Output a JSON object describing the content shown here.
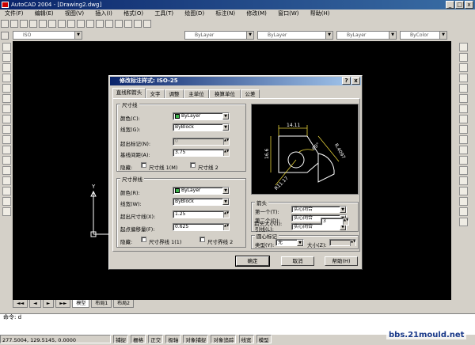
{
  "window": {
    "title": "AutoCAD 2004 - [Drawing2.dwg]",
    "min": "_",
    "max": "□",
    "close": "x"
  },
  "menu": [
    "文件(F)",
    "编辑(E)",
    "视图(V)",
    "插入(I)",
    "格式(O)",
    "工具(T)",
    "绘图(D)",
    "标注(N)",
    "修改(M)",
    "窗口(W)",
    "帮助(H)"
  ],
  "layers": {
    "layer_combo": "ByLayer",
    "linetype_combo": "ByLayer",
    "lineweight_combo": "ByLayer",
    "color_combo": "ByColor",
    "style_combo": "ISO"
  },
  "dialog": {
    "title": "修改标注样式: ISO-25",
    "tabs": [
      "直线和箭头",
      "文字",
      "调整",
      "主单位",
      "换算单位",
      "公差"
    ],
    "dimline": {
      "group_title": "尺寸线",
      "color_label": "颜色(C):",
      "color_value": "ByLayer",
      "lineweight_label": "线宽(G):",
      "lineweight_value": "ByBlock",
      "extend_label": "超出标记(N):",
      "extend_value": "0",
      "baseline_label": "基线间距(A):",
      "baseline_value": "3.75",
      "suppress_label": "隐藏:",
      "suppress1": "尺寸线 1(M)",
      "suppress2": "尺寸线 2"
    },
    "extline": {
      "group_title": "尺寸界线",
      "color_label": "颜色(R):",
      "color_value": "ByLayer",
      "lineweight_label": "线宽(W):",
      "lineweight_value": "ByBlock",
      "extend_label": "超出尺寸线(X):",
      "extend_value": "1.25",
      "offset_label": "起点偏移量(F):",
      "offset_value": "0.625",
      "suppress_label": "隐藏:",
      "suppress1": "尺寸界线 1(1)",
      "suppress2": "尺寸界线 2"
    },
    "arrows": {
      "group_title": "箭头",
      "first_label": "第一个(T):",
      "first_value": "实心闭合",
      "second_label": "第二个(D):",
      "second_value": "实心闭合",
      "leader_label": "引线(L):",
      "leader_value": "实心闭合",
      "size_label": "箭头大小(I):",
      "size_value": "3"
    },
    "center": {
      "group_title": "圆心标记",
      "type_label": "类型(Y):",
      "type_value": "无",
      "size_label": "大小(Z):"
    },
    "preview_labels": {
      "top": "14.11",
      "left": "16.6",
      "right": "R.4097",
      "angle": "60°",
      "bottom": "R11.17"
    },
    "ok": "确定",
    "cancel": "取消",
    "help": "帮助(H)"
  },
  "layout_tabs": [
    "模型",
    "布局1",
    "布局2"
  ],
  "command": {
    "prompt": "命令: d"
  },
  "status": {
    "coords": "277.5004, 129.5145, 0.0000",
    "toggles": [
      "捕捉",
      "栅格",
      "正交",
      "极轴",
      "对象捕捉",
      "对象追踪",
      "线宽",
      "模型"
    ]
  },
  "watermark": "bbs.21mould.net"
}
